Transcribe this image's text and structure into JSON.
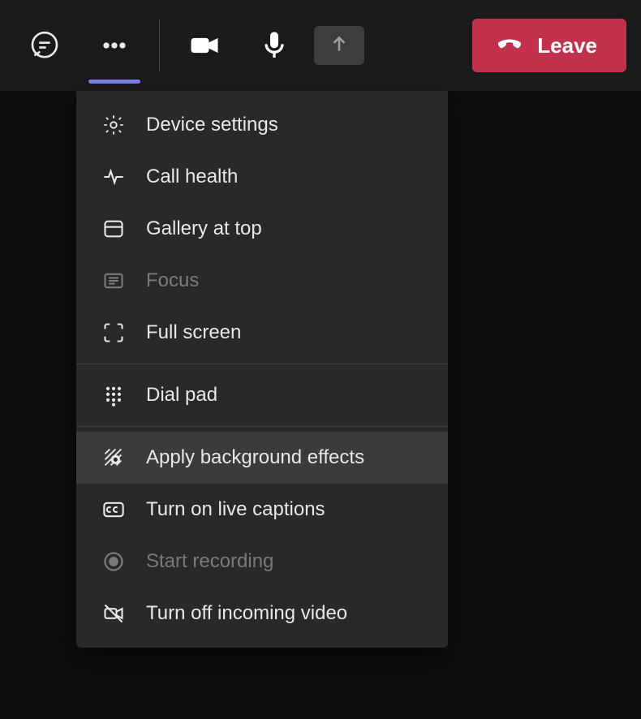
{
  "toolbar": {
    "chat_icon": "chat",
    "more_icon": "more",
    "camera_icon": "camera",
    "mic_icon": "mic",
    "share_icon": "share",
    "leave_label": "Leave"
  },
  "menu": {
    "groups": [
      [
        {
          "icon": "gear",
          "label": "Device settings",
          "disabled": false,
          "hover": false
        },
        {
          "icon": "heartbeat",
          "label": "Call health",
          "disabled": false,
          "hover": false
        },
        {
          "icon": "gallery",
          "label": "Gallery at top",
          "disabled": false,
          "hover": false
        },
        {
          "icon": "focus",
          "label": "Focus",
          "disabled": true,
          "hover": false
        },
        {
          "icon": "fullscreen",
          "label": "Full screen",
          "disabled": false,
          "hover": false
        }
      ],
      [
        {
          "icon": "dialpad",
          "label": "Dial pad",
          "disabled": false,
          "hover": false
        }
      ],
      [
        {
          "icon": "bgeffects",
          "label": "Apply background effects",
          "disabled": false,
          "hover": true
        },
        {
          "icon": "cc",
          "label": "Turn on live captions",
          "disabled": false,
          "hover": false
        },
        {
          "icon": "record",
          "label": "Start recording",
          "disabled": true,
          "hover": false
        },
        {
          "icon": "videooff",
          "label": "Turn off incoming video",
          "disabled": false,
          "hover": false
        }
      ]
    ]
  }
}
